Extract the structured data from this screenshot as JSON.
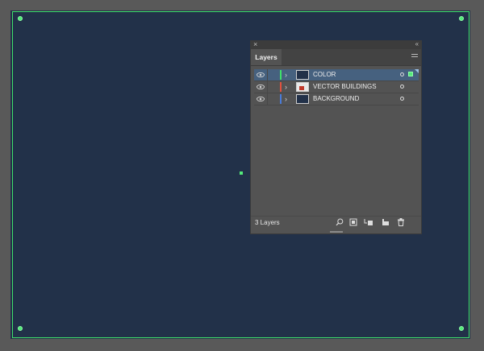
{
  "colors": {
    "artboard": "#223149",
    "selection": "#53ea7a",
    "panel": "#535353",
    "row_selected": "#46617f"
  },
  "panel": {
    "close_glyph": "×",
    "collapse_glyph": "‹‹",
    "tab_label": "Layers",
    "footer": {
      "layer_count": "3 Layers"
    }
  },
  "layers": [
    {
      "name": "COLOR",
      "color": "#3fe06a",
      "selected": true
    },
    {
      "name": "VECTOR BUILDINGS",
      "color": "#e0523f",
      "selected": false
    },
    {
      "name": "BACKGROUND",
      "color": "#4a7bd8",
      "selected": false
    }
  ],
  "icons": {
    "footer": [
      "search-icon",
      "clipping-mask-icon",
      "new-sublayer-icon",
      "new-layer-icon",
      "trash-icon"
    ]
  }
}
